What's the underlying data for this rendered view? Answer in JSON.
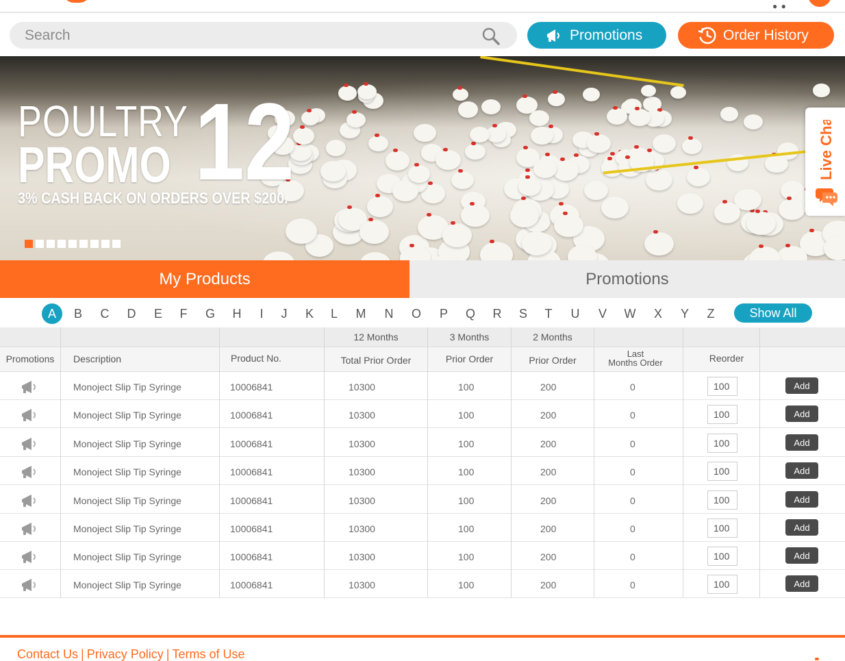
{
  "header": {
    "search_placeholder": "Search",
    "promotions_button": "Promotions",
    "order_history_button": "Order History"
  },
  "banner": {
    "line1": "POULTRY",
    "line2": "PROMO",
    "number": "12",
    "tagline": "3% CASH BACK ON ORDERS OVER $200.",
    "slides": 9,
    "active_slide": 1
  },
  "live_chat": {
    "label": "Live Chat"
  },
  "tabs": {
    "my_products": "My Products",
    "promotions": "Promotions",
    "active": "My Products"
  },
  "alphabet": {
    "letters": [
      "A",
      "B",
      "C",
      "D",
      "E",
      "F",
      "G",
      "H",
      "I",
      "J",
      "K",
      "L",
      "M",
      "N",
      "O",
      "P",
      "Q",
      "R",
      "S",
      "T",
      "U",
      "V",
      "W",
      "X",
      "Y",
      "Z"
    ],
    "active": "A",
    "show_all": "Show All"
  },
  "table": {
    "group_headers": {
      "twelve": "12 Months",
      "three": "3 Months",
      "two": "2 Months"
    },
    "columns": {
      "promotions": "Promotions",
      "description": "Description",
      "product_no": "Product No.",
      "total_prior_order": "Total Prior Order",
      "prior_order_3": "Prior Order",
      "prior_order_2": "Prior Order",
      "last_months_order_line1": "Last",
      "last_months_order_line2": "Months Order",
      "reorder": "Reorder"
    },
    "add_label": "Add",
    "rows": [
      {
        "description": "Monoject Slip Tip Syringe",
        "product_no": "10006841",
        "total_12": "10300",
        "prior_3": "100",
        "prior_2": "200",
        "last": "0",
        "reorder": "100"
      },
      {
        "description": "Monoject Slip Tip Syringe",
        "product_no": "10006841",
        "total_12": "10300",
        "prior_3": "100",
        "prior_2": "200",
        "last": "0",
        "reorder": "100"
      },
      {
        "description": "Monoject Slip Tip Syringe",
        "product_no": "10006841",
        "total_12": "10300",
        "prior_3": "100",
        "prior_2": "200",
        "last": "0",
        "reorder": "100"
      },
      {
        "description": "Monoject Slip Tip Syringe",
        "product_no": "10006841",
        "total_12": "10300",
        "prior_3": "100",
        "prior_2": "200",
        "last": "0",
        "reorder": "100"
      },
      {
        "description": "Monoject Slip Tip Syringe",
        "product_no": "10006841",
        "total_12": "10300",
        "prior_3": "100",
        "prior_2": "200",
        "last": "0",
        "reorder": "100"
      },
      {
        "description": "Monoject Slip Tip Syringe",
        "product_no": "10006841",
        "total_12": "10300",
        "prior_3": "100",
        "prior_2": "200",
        "last": "0",
        "reorder": "100"
      },
      {
        "description": "Monoject Slip Tip Syringe",
        "product_no": "10006841",
        "total_12": "10300",
        "prior_3": "100",
        "prior_2": "200",
        "last": "0",
        "reorder": "100"
      },
      {
        "description": "Monoject Slip Tip Syringe",
        "product_no": "10006841",
        "total_12": "10300",
        "prior_3": "100",
        "prior_2": "200",
        "last": "0",
        "reorder": "100"
      }
    ]
  },
  "footer": {
    "contact": "Contact Us",
    "privacy": "Privacy Policy",
    "terms": "Terms of Use",
    "separator": "|"
  },
  "colors": {
    "accent_orange": "#ff6b1f",
    "accent_teal": "#17a2c2",
    "add_button": "#4a4a4a"
  },
  "icons": {
    "search": "search-icon",
    "promotions": "megaphone-icon",
    "order_history": "clock-icon",
    "live_chat": "chat-bubble-icon",
    "row_promotion": "megaphone-icon"
  }
}
